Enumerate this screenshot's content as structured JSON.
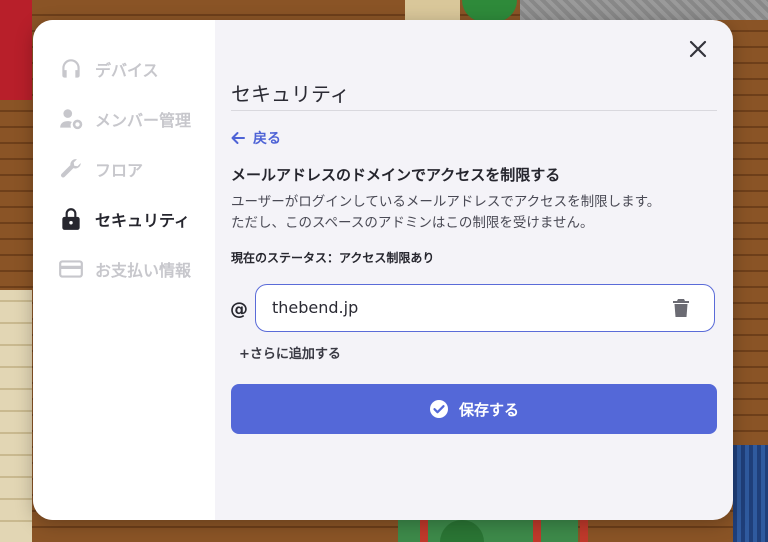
{
  "sidebar": {
    "items": [
      {
        "label": "デバイス",
        "icon": "headphones-icon",
        "active": false
      },
      {
        "label": "メンバー管理",
        "icon": "user-gear-icon",
        "active": false
      },
      {
        "label": "フロア",
        "icon": "wrench-icon",
        "active": false
      },
      {
        "label": "セキュリティ",
        "icon": "lock-icon",
        "active": true
      },
      {
        "label": "お支払い情報",
        "icon": "credit-card-icon",
        "active": false
      }
    ]
  },
  "main": {
    "title": "セキュリティ",
    "back_label": "戻る",
    "heading": "メールアドレスのドメインでアクセスを制限する",
    "description_line1": "ユーザーがログインしているメールアドレスでアクセスを制限します。",
    "description_line2": "ただし、このスペースのアドミンはこの制限を受けません。",
    "status": "現在のステータス：アクセス制限あり",
    "at_symbol": "@",
    "domain_value": "thebend.jp",
    "add_more_label": "+さらに追加する",
    "save_label": "保存する"
  },
  "colors": {
    "accent": "#5468d8",
    "link": "#4e63d6",
    "sidebar_inactive": "#c7c7cc",
    "sidebar_active": "#26262e"
  }
}
